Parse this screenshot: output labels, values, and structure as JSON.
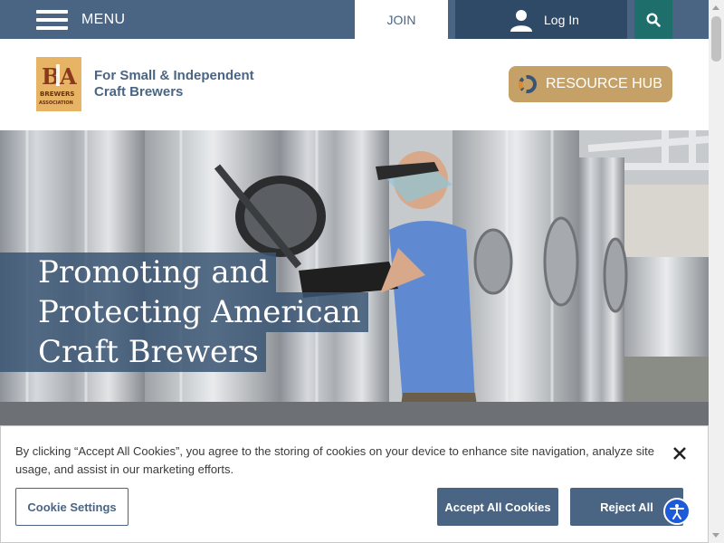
{
  "topbar": {
    "menu_label": "MENU",
    "join_label": "JOIN",
    "login_label": "Log In",
    "search_icon": "search-icon",
    "colors": {
      "bar": "#4a6584",
      "login": "#2f4a66",
      "search": "#1e6e6c"
    }
  },
  "header": {
    "logo_text": "B A BREWERS ASSOCIATION",
    "tagline_line1": "For Small & Independent",
    "tagline_line2": "Craft Brewers",
    "resource_hub_label": "RESOURCE HUB",
    "colors": {
      "resource": "#c6a167"
    }
  },
  "hero": {
    "headline_line1": "Promoting and",
    "headline_line2": "Protecting American",
    "headline_line3": "Craft Brewers"
  },
  "cookie_banner": {
    "text": "By clicking “Accept All Cookies”, you agree to the storing of cookies on your device to enhance site navigation, analyze site usage, and assist in our marketing efforts.",
    "settings_label": "Cookie Settings",
    "accept_label": "Accept All Cookies",
    "reject_label": "Reject All",
    "close_icon": "close-icon"
  },
  "accessibility": {
    "icon": "accessibility-icon",
    "color": "#1d5bd8"
  }
}
